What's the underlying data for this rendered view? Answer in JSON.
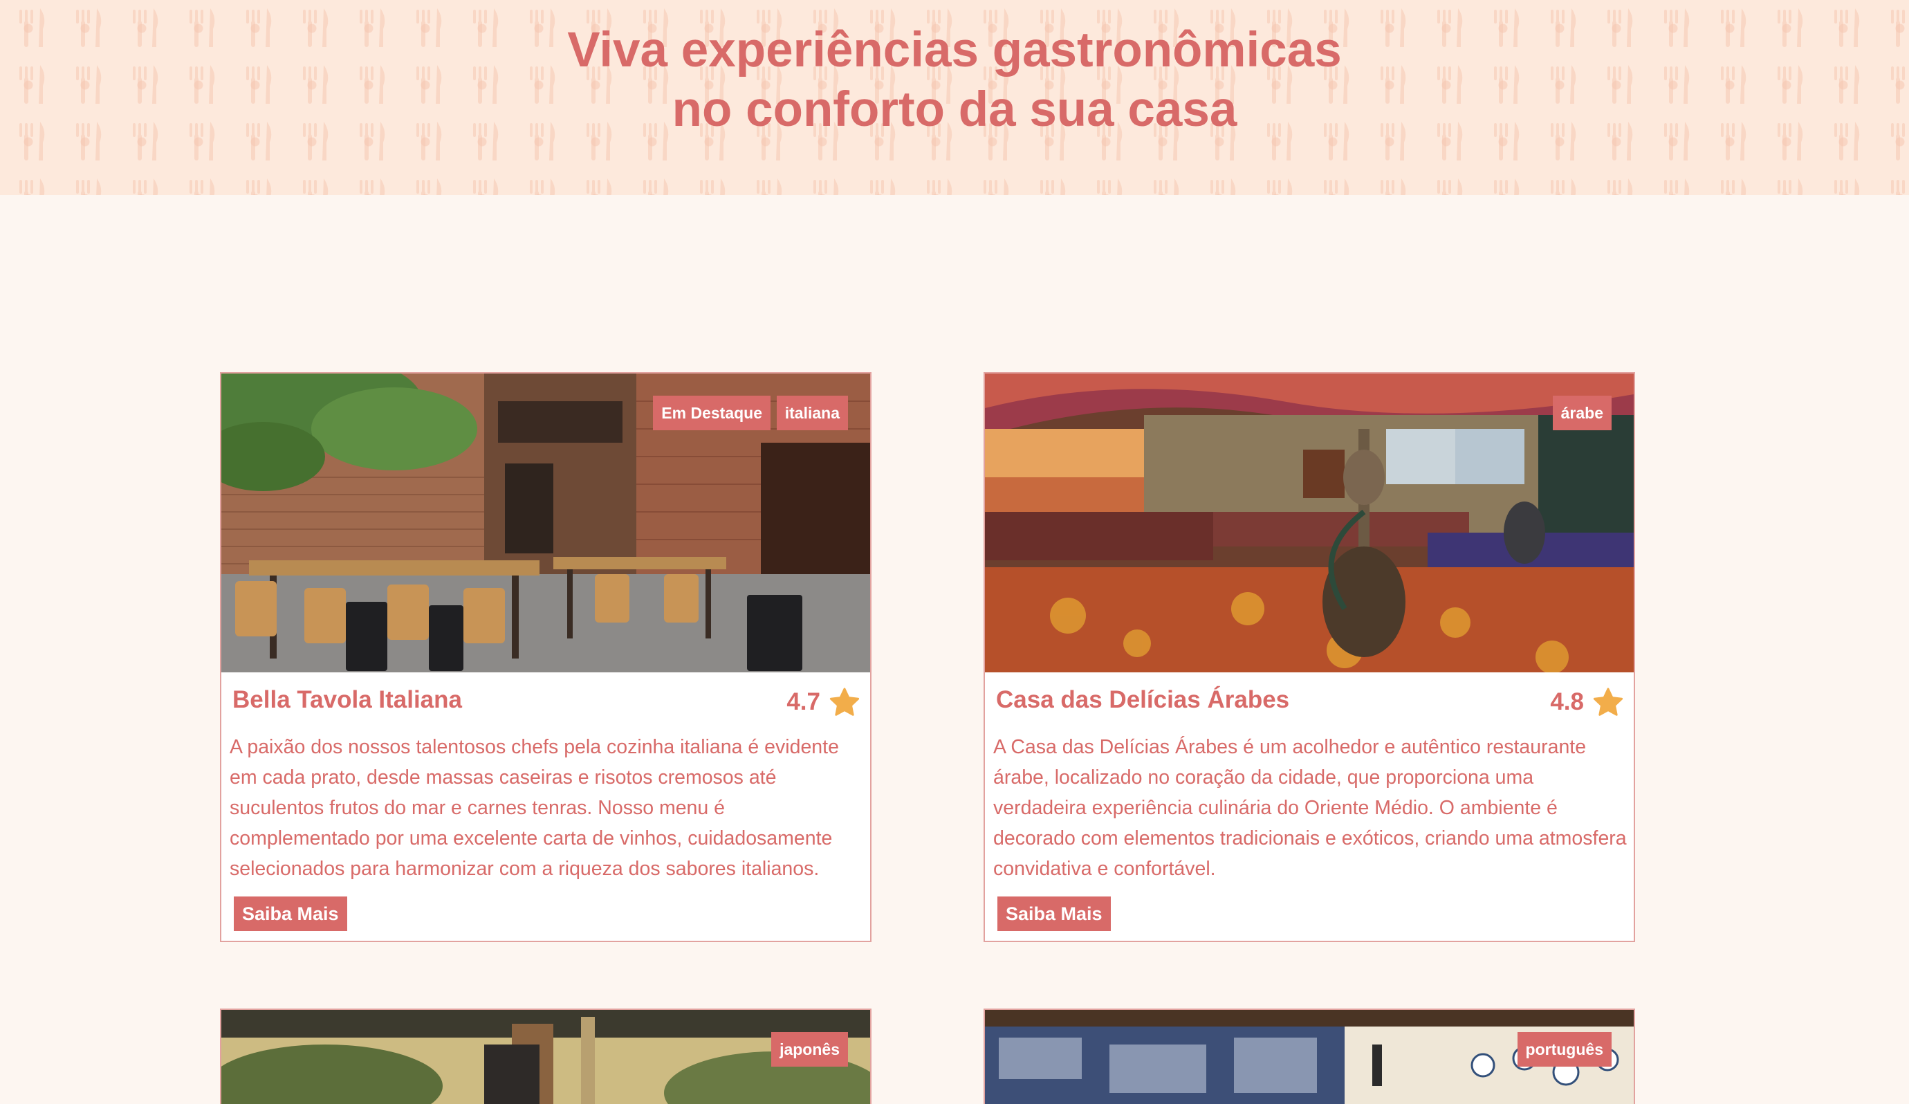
{
  "hero": {
    "title_line1": "Viva experiências gastronômicas",
    "title_line2": "no conforto da sua casa",
    "pattern_icon": "fork-knife-pattern-icon"
  },
  "colors": {
    "accent": "#d86a68",
    "hero_bg": "#fde9dc",
    "page_bg": "#fdf6f1",
    "star": "#f2ad4a"
  },
  "restaurants": [
    {
      "name": "Bella Tavola Italiana",
      "rating": "4.7",
      "tags": [
        "Em Destaque",
        "italiana"
      ],
      "description": "A paixão dos nossos talentosos chefs pela cozinha italiana é evidente em cada prato, desde massas caseiras e risotos cremosos até suculentos frutos do mar e carnes tenras. Nosso menu é complementado por uma excelente carta de vinhos, cuidadosamente selecionados para harmonizar com a riqueza dos sabores italianos.",
      "button": "Saiba Mais",
      "image": "restaurant-interior-photo"
    },
    {
      "name": "Casa das Delícias Árabes",
      "rating": "4.8",
      "tags": [
        "árabe"
      ],
      "description": "A Casa das Delícias Árabes é um acolhedor e autêntico restaurante árabe, localizado no coração da cidade, que proporciona uma verdadeira experiência culinária do Oriente Médio. O ambiente é decorado com elementos tradicionais e exóticos, criando uma atmosfera convidativa e confortável.",
      "button": "Saiba Mais",
      "image": "arabic-lounge-photo"
    },
    {
      "tags": [
        "japonês"
      ],
      "image": "sushi-house-photo"
    },
    {
      "tags": [
        "português"
      ],
      "image": "portuguese-tiles-photo"
    }
  ]
}
